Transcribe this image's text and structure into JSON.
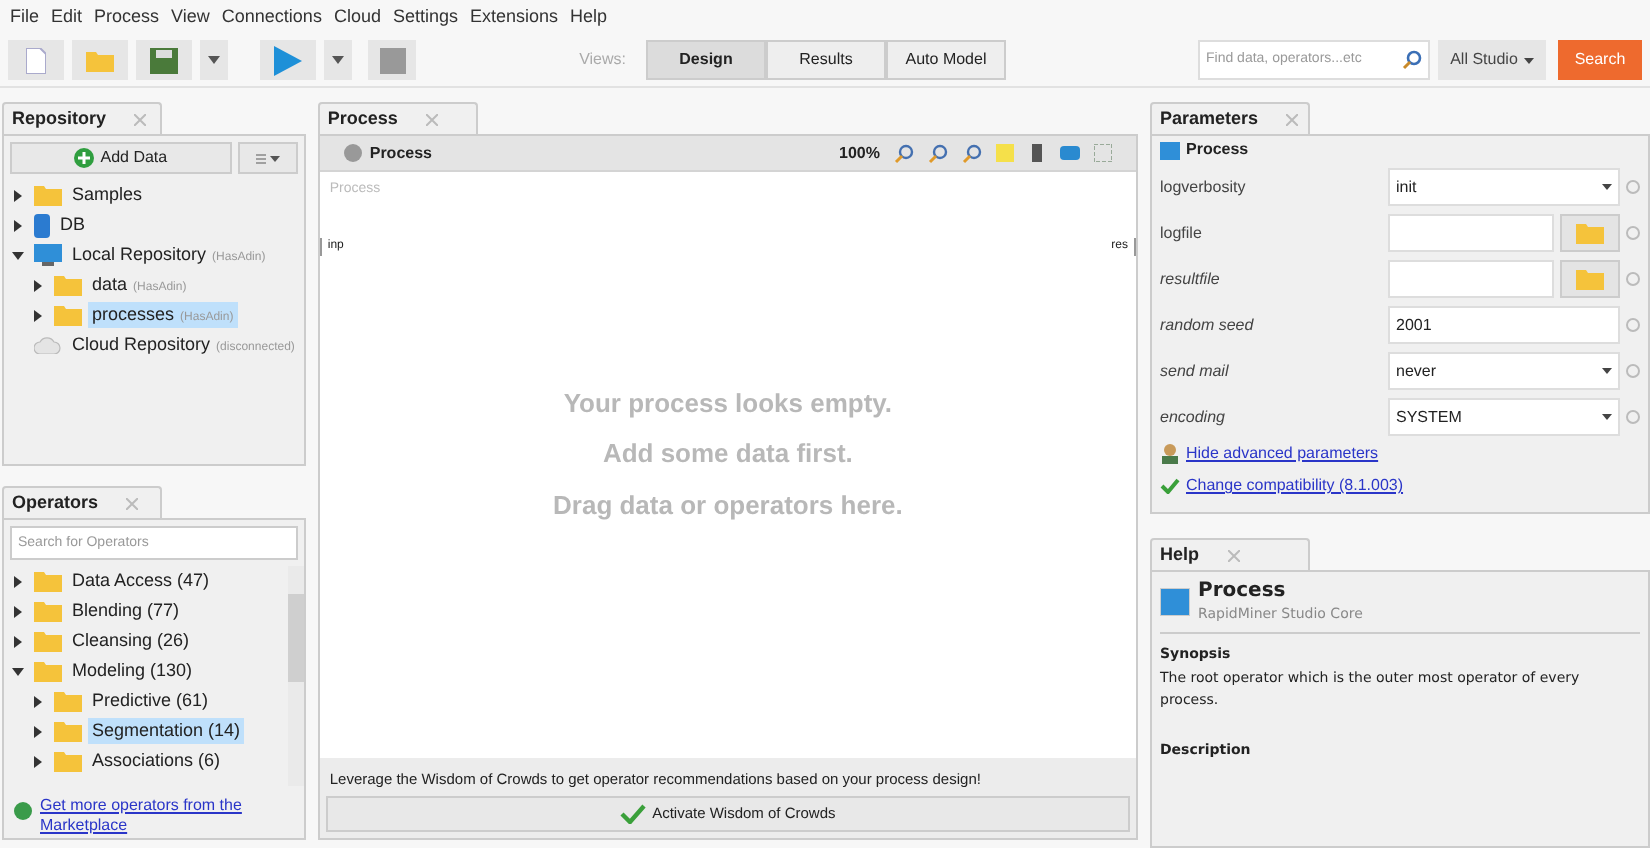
{
  "menu": [
    "File",
    "Edit",
    "Process",
    "View",
    "Connections",
    "Cloud",
    "Settings",
    "Extensions",
    "Help"
  ],
  "toolbar": {
    "views_label": "Views:",
    "views": [
      {
        "label": "Design",
        "selected": true
      },
      {
        "label": "Results",
        "selected": false
      },
      {
        "label": "Auto Model",
        "selected": false
      }
    ],
    "search_placeholder": "Find data, operators...etc",
    "scope": "All Studio",
    "search_button": "Search"
  },
  "repository": {
    "tab": "Repository",
    "add_data": "Add Data",
    "items": [
      {
        "kind": "folder",
        "label": "Samples",
        "expanded": false,
        "selected": false
      },
      {
        "kind": "database",
        "label": "DB",
        "expanded": false,
        "selected": false
      },
      {
        "kind": "computer",
        "label": "Local Repository",
        "note": "(HasAdin)",
        "expanded": true,
        "selected": false,
        "children": [
          {
            "kind": "folder",
            "label": "data",
            "note": "(HasAdin)",
            "expanded": false,
            "selected": false
          },
          {
            "kind": "folder",
            "label": "processes",
            "note": "(HasAdin)",
            "expanded": false,
            "selected": true
          }
        ]
      },
      {
        "kind": "cloud",
        "label": "Cloud Repository",
        "note": "(disconnected)",
        "selected": false
      }
    ]
  },
  "operators": {
    "tab": "Operators",
    "search_placeholder": "Search for Operators",
    "items": [
      {
        "kind": "folder",
        "label": "Data Access (47)",
        "expanded": false,
        "selected": false
      },
      {
        "kind": "folder",
        "label": "Blending (77)",
        "expanded": false,
        "selected": false
      },
      {
        "kind": "folder",
        "label": "Cleansing (26)",
        "expanded": false,
        "selected": false
      },
      {
        "kind": "folder",
        "label": "Modeling (130)",
        "expanded": true,
        "selected": false,
        "children": [
          {
            "kind": "folder",
            "label": "Predictive (61)",
            "expanded": false,
            "selected": false
          },
          {
            "kind": "folder",
            "label": "Segmentation (14)",
            "expanded": false,
            "selected": true
          },
          {
            "kind": "folder",
            "label": "Associations (6)",
            "expanded": false,
            "selected": false
          }
        ]
      }
    ],
    "marketplace_link": "Get more operators from the Marketplace"
  },
  "process": {
    "tab": "Process",
    "header": "Process",
    "zoom": "100%",
    "canvas_label": "Process",
    "port_in": "inp",
    "port_out": "res",
    "empty_message": [
      "Your process looks empty.",
      "Add some data first.",
      "Drag data or operators here."
    ],
    "wisdom_text": "Leverage the Wisdom of Crowds to get operator recommendations based on your process design!",
    "wisdom_button": "Activate Wisdom of Crowds"
  },
  "parameters": {
    "tab": "Parameters",
    "header": "Process",
    "rows": [
      {
        "kind": "select",
        "label": "logverbosity",
        "value": "init",
        "advanced": false
      },
      {
        "kind": "file",
        "label": "logfile",
        "advanced": false
      },
      {
        "kind": "file",
        "label": "resultfile",
        "advanced": true
      },
      {
        "kind": "text",
        "label": "random seed",
        "value": "2001",
        "advanced": true
      },
      {
        "kind": "select",
        "label": "send mail",
        "value": "never",
        "advanced": true
      },
      {
        "kind": "select",
        "label": "encoding",
        "value": "SYSTEM",
        "advanced": true
      }
    ],
    "hide_advanced_link": "Hide advanced parameters",
    "compatibility_link": "Change compatibility (8.1.003)"
  },
  "help": {
    "tab": "Help",
    "title": "Process",
    "subtitle": "RapidMiner Studio Core",
    "synopsis_heading": "Synopsis",
    "synopsis": "The root operator which is the outer most operator of every process.",
    "description_heading": "Description"
  }
}
